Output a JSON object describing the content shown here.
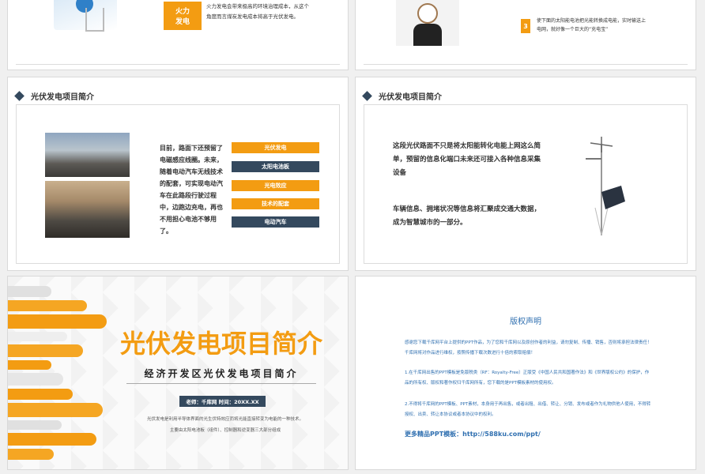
{
  "slide1": {
    "badge": "火力\n发电",
    "text": "火力发电会带来极高的环境治理成本，从这个角度而言煤炭发电成本将高于光伏发电。"
  },
  "slide2": {
    "step_num": "3",
    "text": "使下面的太阳能电池把光能转换成电能，实时输送上电网，就好像一个巨大的“充电宝”"
  },
  "slide3": {
    "section_title": "光伏发电项目简介",
    "body": "目前，路面下还预留了电磁感应线圈。未来，随着电动汽车无线技术的配套，可实现电动汽车在此路段行驶过程中，边跑边充电，再也不用担心电池不够用了。",
    "tags": [
      "光伏发电",
      "太阳电池板",
      "光电效应",
      "技术的配套",
      "电动汽车"
    ]
  },
  "slide4": {
    "section_title": "光伏发电项目简介",
    "para1": "这段光伏路面不只是将太阳能转化电能上网这么简单，预留的信息化端口未来还可接入各种信息采集设备",
    "para2": "车辆信息、拥堵状况等信息将汇聚成交通大数据，成为智慧城市的一部分。"
  },
  "slide5": {
    "title": "光伏发电项目简介",
    "subtitle": "经济开发区光伏发电项目简介",
    "teacher_bar": "老师：千库网  时间：20XX.XX",
    "desc1": "光伏发电是利用半导体界面的光生伏特效应而将光能直接转变为电能的一种技术。",
    "desc2": "主要由太阳电池板（组件）、控制器和逆变器三大部分组成"
  },
  "slide6": {
    "title": "版权声明",
    "intro": "感谢您下载千库网平台上提供的PPT作品，为了您和千库网以及原创作者的利益，请勿复制、传播、销售，否则将承担法律责任！千库网将对作品进行维权，按照传播下载次数进行十倍的索取赔偿！",
    "p1": "1.在千库网出售的PPT模板是免版税类（RF：Royalty-Free）正版受《中国人民共和国著作法》和《世界版权公约》的保护，作品的所有权、版权和著作权归千库网所有，您下载的是PPT模板素材的使用权。",
    "p2": "2.不得将千库网的PPT模板、PPT素材，本身用于再出售，或者出租、出借、转让、分销、发布或者作为礼物供他人使用，不得转授权、出卖、转让本协议或者本协议中的权利。",
    "more": "更多精品PPT模板：http://588ku.com/ppt/"
  }
}
